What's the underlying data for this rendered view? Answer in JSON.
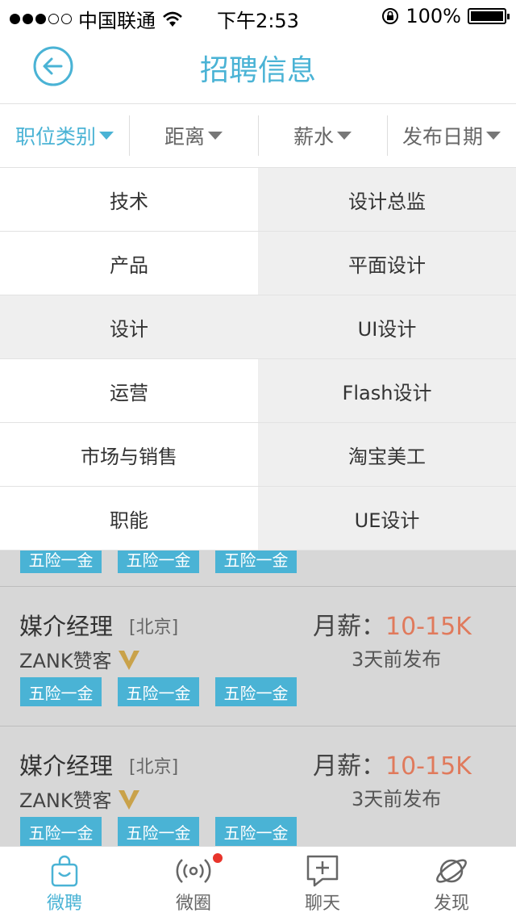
{
  "status_bar": {
    "carrier": "中国联通",
    "time": "下午2:53",
    "battery": "100%"
  },
  "header": {
    "title": "招聘信息"
  },
  "filters": [
    {
      "label": "职位类别",
      "active": true
    },
    {
      "label": "距离",
      "active": false
    },
    {
      "label": "薪水",
      "active": false
    },
    {
      "label": "发布日期",
      "active": false
    }
  ],
  "categories": {
    "left": [
      "技术",
      "产品",
      "设计",
      "运营",
      "市场与销售",
      "职能"
    ],
    "right": [
      "设计总监",
      "平面设计",
      "UI设计",
      "Flash设计",
      "淘宝美工",
      "UE设计"
    ],
    "selected_left": "设计"
  },
  "jobs": [
    {
      "tags": [
        "五险一金",
        "五险一金",
        "五险一金"
      ]
    },
    {
      "title": "媒介经理",
      "city": "[北京]",
      "company": "ZANK赞客",
      "salary_label": "月薪：",
      "salary": "10-15K",
      "posted": "3天前发布",
      "tags": [
        "五险一金",
        "五险一金",
        "五险一金"
      ]
    },
    {
      "title": "媒介经理",
      "city": "[北京]",
      "company": "ZANK赞客",
      "salary_label": "月薪：",
      "salary": "10-15K",
      "posted": "3天前发布",
      "tags": [
        "五险一金",
        "五险一金",
        "五险一金"
      ]
    }
  ],
  "tabbar": [
    {
      "label": "微聘",
      "icon": "bag-icon",
      "active": true
    },
    {
      "label": "微圈",
      "icon": "broadcast-icon",
      "active": false,
      "badge": true
    },
    {
      "label": "聊天",
      "icon": "chat-plus-icon",
      "active": false
    },
    {
      "label": "发现",
      "icon": "planet-icon",
      "active": false
    }
  ],
  "colors": {
    "accent": "#4ab3d5",
    "salary": "#e07a5c",
    "badge": "#e8342b"
  }
}
